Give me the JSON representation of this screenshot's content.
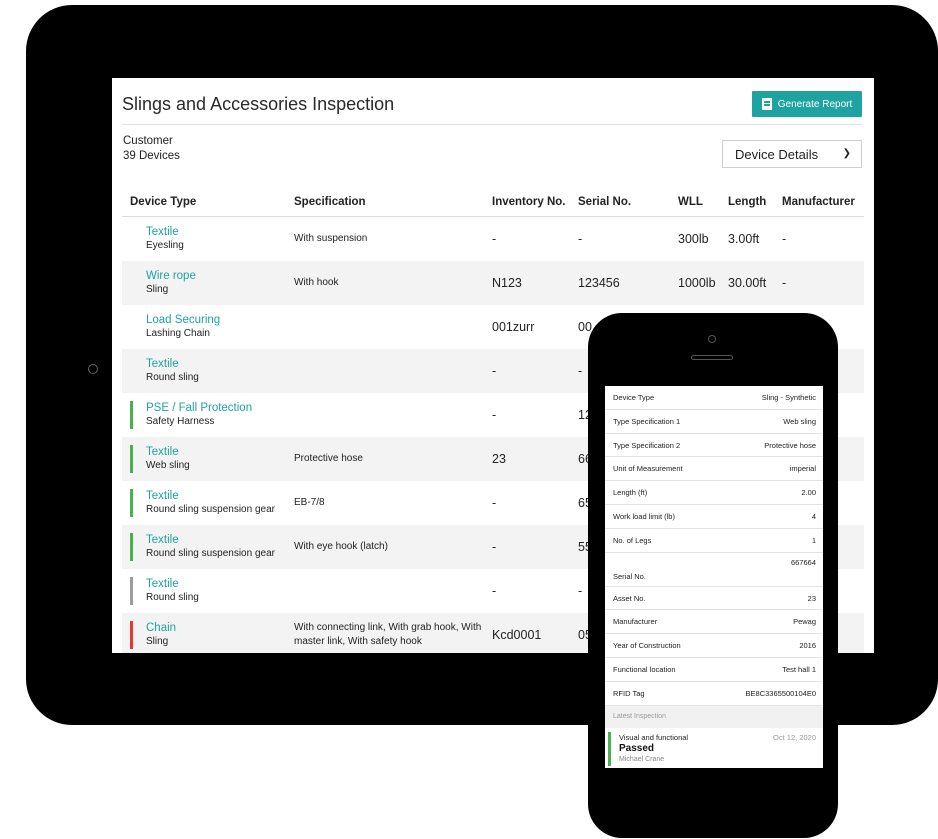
{
  "page": {
    "title": "Slings and Accessories Inspection",
    "generate_report_label": "Generate Report",
    "customer_label": "Customer",
    "device_count": "39 Devices",
    "details_select_value": "Device Details"
  },
  "table": {
    "headers": [
      "Device Type",
      "Specification",
      "Inventory No.",
      "Serial No.",
      "WLL",
      "Length",
      "Manufacturer"
    ],
    "rows": [
      {
        "type": "Textile",
        "sub": "Eyesling",
        "spec": "With suspension",
        "inv": "-",
        "serial": "-",
        "wll": "300lb",
        "length": "3.00ft",
        "mfr": "-",
        "status": ""
      },
      {
        "type": "Wire rope",
        "sub": "Sling",
        "spec": "With hook",
        "inv": "N123",
        "serial": "123456",
        "wll": "1000lb",
        "length": "30.00ft",
        "mfr": "-",
        "status": ""
      },
      {
        "type": "Load Securing",
        "sub": "Lashing Chain",
        "spec": "",
        "inv": "001zurr",
        "serial": "00",
        "wll": "",
        "length": "",
        "mfr": "",
        "status": ""
      },
      {
        "type": "Textile",
        "sub": "Round sling",
        "spec": "",
        "inv": "-",
        "serial": "-",
        "wll": "",
        "length": "",
        "mfr": "",
        "status": ""
      },
      {
        "type": "PSE / Fall Protection",
        "sub": "Safety Harness",
        "spec": "",
        "inv": "-",
        "serial": "12",
        "wll": "",
        "length": "",
        "mfr": "",
        "status": "#4caf50"
      },
      {
        "type": "Textile",
        "sub": "Web sling",
        "spec": "Protective hose",
        "inv": "23",
        "serial": "66",
        "wll": "",
        "length": "",
        "mfr": "",
        "status": "#4caf50"
      },
      {
        "type": "Textile",
        "sub": "Round sling suspension gear",
        "spec": "EB-7/8",
        "inv": "-",
        "serial": "65",
        "wll": "",
        "length": "",
        "mfr": "",
        "status": "#4caf50"
      },
      {
        "type": "Textile",
        "sub": "Round sling suspension gear",
        "spec": "With eye hook (latch)",
        "inv": "-",
        "serial": "55",
        "wll": "",
        "length": "",
        "mfr": "",
        "status": "#4caf50"
      },
      {
        "type": "Textile",
        "sub": "Round sling",
        "spec": "",
        "inv": "-",
        "serial": "-",
        "wll": "",
        "length": "",
        "mfr": "",
        "status": "#9e9e9e"
      },
      {
        "type": "Chain",
        "sub": "Sling",
        "spec": "With connecting link, With grab hook, With master link, With safety hook",
        "inv": "Kcd0001",
        "serial": "05",
        "wll": "",
        "length": "",
        "mfr": "",
        "status": "#e53935"
      }
    ]
  },
  "phone": {
    "details": [
      {
        "label": "Device Type",
        "value": "Sling - Synthetic"
      },
      {
        "label": "Type Specification 1",
        "value": "Web sling"
      },
      {
        "label": "Type Specification 2",
        "value": "Protective hose"
      },
      {
        "label": "Unit of Measurement",
        "value": "imperial"
      },
      {
        "label": "Length (ft)",
        "value": "2.00"
      },
      {
        "label": "Work load limit (lb)",
        "value": "4"
      },
      {
        "label": "No. of Legs",
        "value": "1"
      },
      {
        "label": "Serial No.",
        "value": "667664"
      },
      {
        "label": "Asset No.",
        "value": "23"
      },
      {
        "label": "Manufacturer",
        "value": "Pewag"
      },
      {
        "label": "Year of Construction",
        "value": "2016"
      },
      {
        "label": "Functional location",
        "value": "Test hall 1"
      },
      {
        "label": "RFID Tag",
        "value": "BE8C3365500104E0"
      }
    ],
    "latest_label": "Latest Inspection",
    "inspection": {
      "kind": "Visual and functional",
      "result": "Passed",
      "inspector": "Michael Crane",
      "date": "Oct 12, 2020"
    }
  },
  "colors": {
    "accent": "#1fa3a0",
    "passed": "#4caf50",
    "failed": "#e53935",
    "neutral": "#9e9e9e"
  }
}
